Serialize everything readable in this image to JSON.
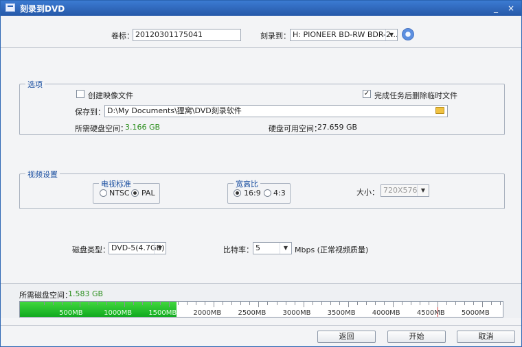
{
  "window": {
    "title": "刻录到DVD",
    "minimize": "_",
    "close": "×"
  },
  "top": {
    "volume_label": "卷标：",
    "volume_value": "20120301175041",
    "burn_to_label": "刻录到：",
    "burn_to_value": "H: PIONEER  BD-RW   BDR-2..."
  },
  "options": {
    "title": "选项",
    "create_image": "创建映像文件",
    "delete_temp": "完成任务后删除临时文件",
    "save_to_label": "保存到：",
    "save_to_value": "D:\\My Documents\\狸窝\\DVD刻录软件",
    "required_label": "所需硬盘空间：",
    "required_value": "3.166 GB",
    "available_label": "硬盘可用空间：",
    "available_value": "27.659 GB"
  },
  "video": {
    "title": "视频设置",
    "tv_standard": {
      "title": "电视标准",
      "ntsc": "NTSC",
      "pal": "PAL",
      "selected": "PAL"
    },
    "aspect": {
      "title": "宽高比",
      "r169": "16:9",
      "r43": "4:3",
      "selected": "16:9"
    },
    "size_label": "大小：",
    "size_value": "720X576"
  },
  "disc": {
    "type_label": "磁盘类型：",
    "type_value": "DVD-5(4.7GB)",
    "bitrate_label": "比特率：",
    "bitrate_value": "5",
    "bitrate_unit": "Mbps (正常视频质量)"
  },
  "usage": {
    "label": "所需磁盘空间：",
    "value": "1.583 GB",
    "fill_mb": 1583,
    "limit_mb": 4500,
    "scale_max_mb": 5400,
    "ticks": [
      "500MB",
      "1000MB",
      "1500MB",
      "2000MB",
      "2500MB",
      "3000MB",
      "3500MB",
      "4000MB",
      "4500MB",
      "5000MB"
    ]
  },
  "buttons": {
    "back": "返回",
    "start": "开始",
    "cancel": "取消"
  },
  "colors": {
    "title_bar": "#2b66bd",
    "accent_text": "#1b4fa0",
    "green": "#2d8f1f",
    "bar_fill": "#19b127",
    "limit_mark": "#d43a3a"
  }
}
